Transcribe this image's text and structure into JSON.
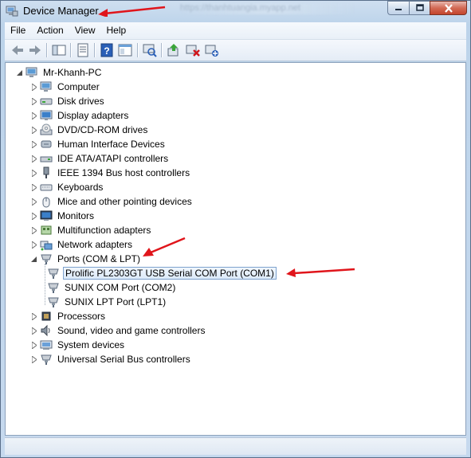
{
  "window": {
    "title": "Device Manager",
    "url_hint": "https://thanhtuangia.myapp.net"
  },
  "caption_icons": [
    "minimize-icon",
    "maximize-icon",
    "close-icon"
  ],
  "menu": [
    "File",
    "Action",
    "View",
    "Help"
  ],
  "toolbar_icons": [
    "back-icon",
    "forward-icon",
    "console-tree-icon",
    "properties-icon",
    "help-icon",
    "view-icon",
    "scan-hardware-icon",
    "update-driver-icon",
    "uninstall-icon",
    "disable-icon"
  ],
  "tree": {
    "root": "Mr-Khanh-PC",
    "categories": {
      "computer": "Computer",
      "disk_drives": "Disk drives",
      "display_adapters": "Display adapters",
      "dvd": "DVD/CD-ROM drives",
      "hid": "Human Interface Devices",
      "ide": "IDE ATA/ATAPI controllers",
      "ieee1394": "IEEE 1394 Bus host controllers",
      "keyboards": "Keyboards",
      "mice": "Mice and other pointing devices",
      "monitors": "Monitors",
      "multifunction": "Multifunction adapters",
      "network": "Network adapters",
      "ports": "Ports (COM & LPT)",
      "processors": "Processors",
      "sound": "Sound, video and game controllers",
      "system": "System devices",
      "usb": "Universal Serial Bus controllers"
    },
    "ports_children": {
      "prolific": "Prolific PL2303GT USB Serial COM Port (COM1)",
      "sunix_com": "SUNIX COM Port (COM2)",
      "sunix_lpt": "SUNIX LPT Port (LPT1)"
    },
    "selected": "Prolific PL2303GT USB Serial COM Port (COM1)"
  },
  "colors": {
    "annotation_arrow": "#e0151b",
    "selection_border": "#7da2ce",
    "selection_fill": "#dceaf9"
  }
}
